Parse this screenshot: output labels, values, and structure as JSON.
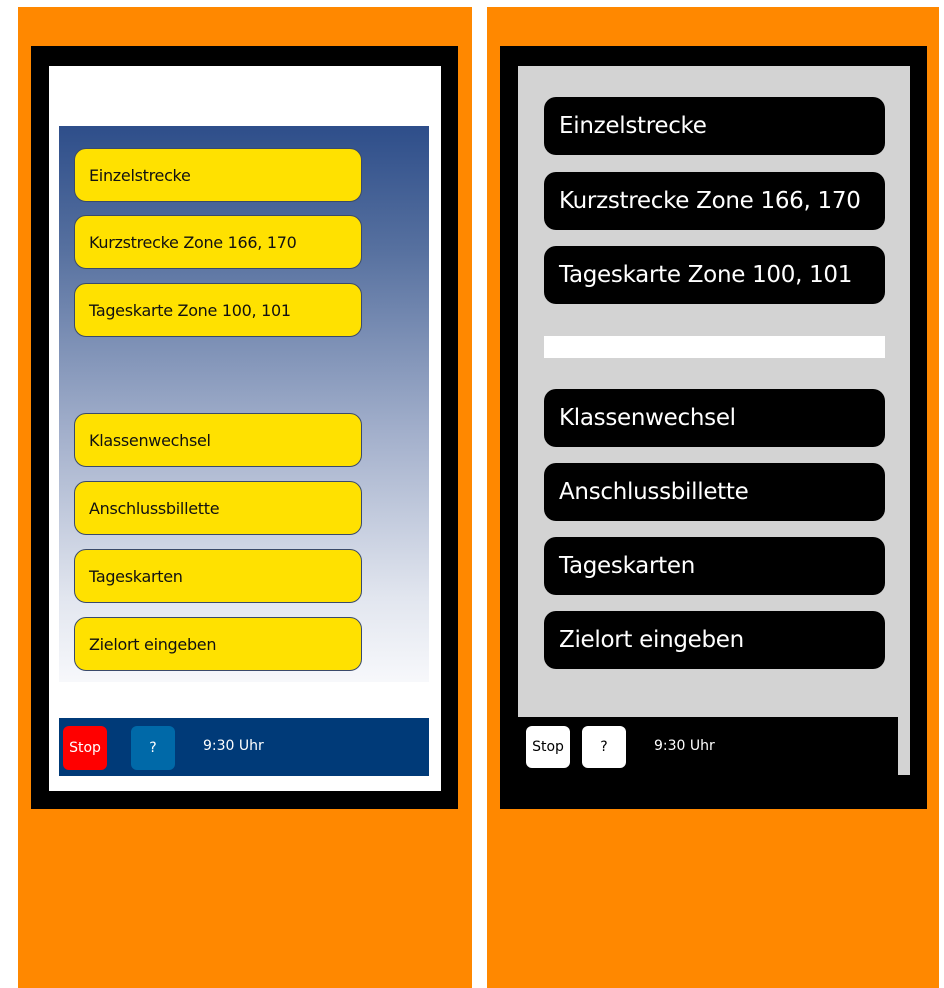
{
  "colors": {
    "orange_background": "#ff8800",
    "bezel": "#000000",
    "left_button_yellow": "#ffe100",
    "left_footer_blue": "#003a78",
    "left_stop_red": "#ff0000",
    "left_help_blue": "#0069a8",
    "right_screen_gray": "#d3d3d3",
    "right_button_black": "#000000"
  },
  "left_screen": {
    "ticket_buttons": [
      {
        "label": "Einzelstrecke"
      },
      {
        "label": "Kurzstrecke Zone 166, 170"
      },
      {
        "label": "Tageskarte Zone 100, 101"
      }
    ],
    "option_buttons": [
      {
        "label": "Klassenwechsel"
      },
      {
        "label": "Anschlussbillette"
      },
      {
        "label": "Tageskarten"
      },
      {
        "label": "Zielort eingeben"
      }
    ],
    "footer": {
      "stop_label": "Stop",
      "help_label": "?",
      "time": "9:30 Uhr"
    }
  },
  "right_screen": {
    "ticket_buttons": [
      {
        "label": "Einzelstrecke"
      },
      {
        "label": "Kurzstrecke Zone 166, 170"
      },
      {
        "label": "Tageskarte Zone 100, 101"
      }
    ],
    "option_buttons": [
      {
        "label": "Klassenwechsel"
      },
      {
        "label": "Anschlussbillette"
      },
      {
        "label": "Tageskarten"
      },
      {
        "label": "Zielort eingeben"
      }
    ],
    "footer": {
      "stop_label": "Stop",
      "help_label": "?",
      "time": "9:30 Uhr"
    }
  }
}
